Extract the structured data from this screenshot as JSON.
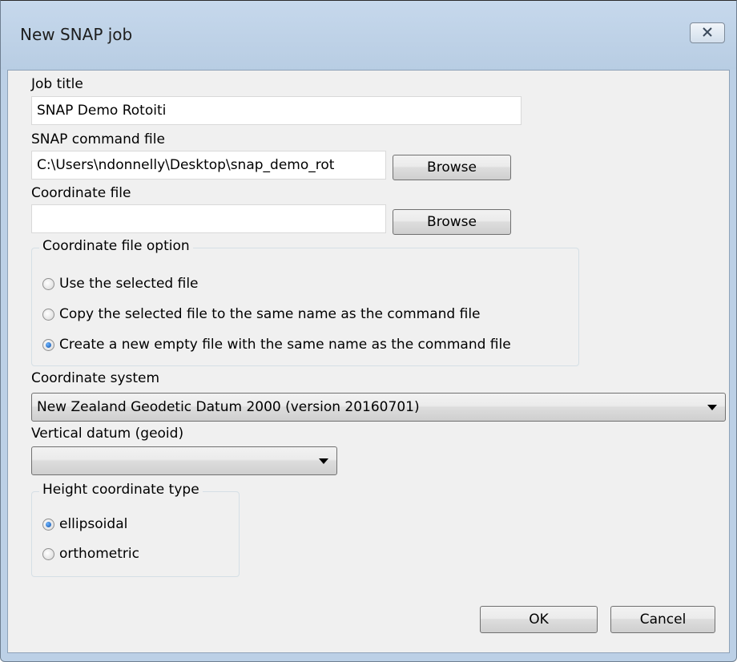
{
  "window": {
    "title": "New SNAP job",
    "close_icon": "close-icon"
  },
  "form": {
    "job_title_label": "Job title",
    "job_title_value": "SNAP Demo Rotoiti",
    "command_file_label": "SNAP command file",
    "command_file_value": "C:\\Users\\ndonnelly\\Desktop\\snap_demo_rot",
    "browse_label": "Browse",
    "coord_file_label": "Coordinate file",
    "coord_file_value": "",
    "coord_option_title": "Coordinate file option",
    "coord_options": [
      {
        "label": "Use the selected file",
        "selected": false
      },
      {
        "label": "Copy the selected file to the same name as the command file",
        "selected": false
      },
      {
        "label": "Create a new empty file with the same name as the command file",
        "selected": true
      }
    ],
    "coord_system_label": "Coordinate system",
    "coord_system_value": "New Zealand Geodetic Datum 2000 (version 20160701)",
    "vertical_datum_label": "Vertical datum (geoid)",
    "vertical_datum_value": "",
    "height_type_title": "Height coordinate type",
    "height_options": [
      {
        "label": "ellipsoidal",
        "selected": true
      },
      {
        "label": "orthometric",
        "selected": false
      }
    ]
  },
  "buttons": {
    "ok": "OK",
    "cancel": "Cancel"
  }
}
